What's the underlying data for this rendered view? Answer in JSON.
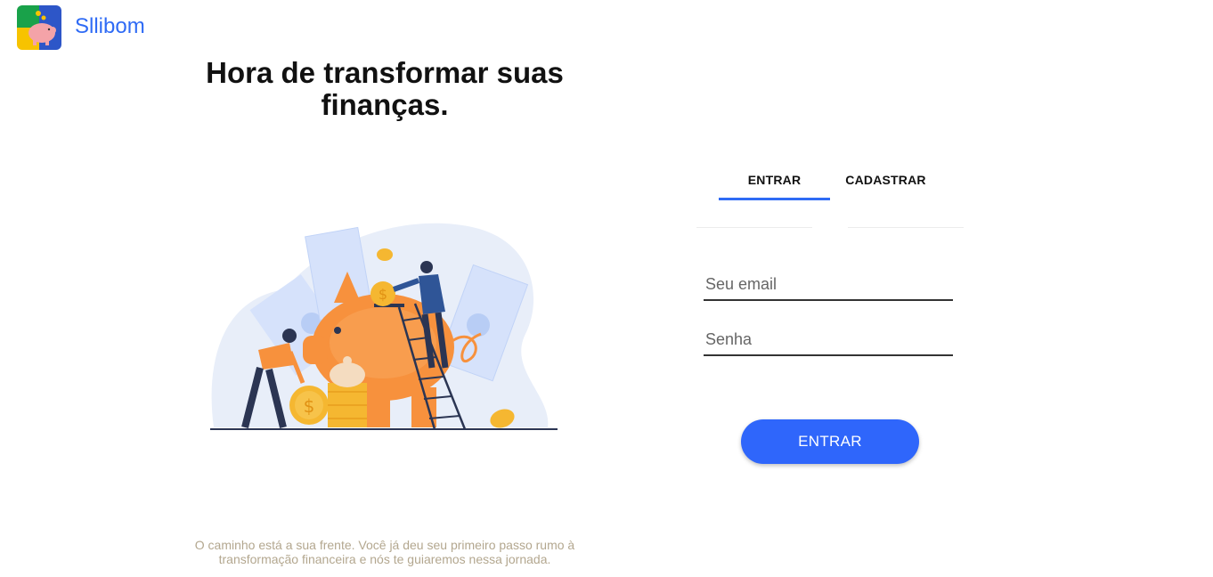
{
  "header": {
    "brand": "Sllibom",
    "logo_icon": "piggy-bank-logo-icon"
  },
  "hero": {
    "headline": "Hora de transformar suas finanças.",
    "illustration": "piggy-bank-savings-illustration",
    "tagline": "O caminho está a sua frente. Você já deu seu primeiro passo rumo à transformação financeira e nós te guiaremos nessa jornada."
  },
  "auth": {
    "tabs": [
      {
        "label": "ENTRAR",
        "active": true
      },
      {
        "label": "CADASTRAR",
        "active": false
      }
    ],
    "email": {
      "placeholder": "Seu email",
      "value": ""
    },
    "password": {
      "placeholder": "Senha",
      "value": ""
    },
    "submit_label": "ENTRAR"
  },
  "colors": {
    "accent": "#2f6bf5",
    "button": "#2f66fb",
    "tagline": "#b3a78f",
    "pig": "#f7913d",
    "coin": "#f5b731"
  }
}
